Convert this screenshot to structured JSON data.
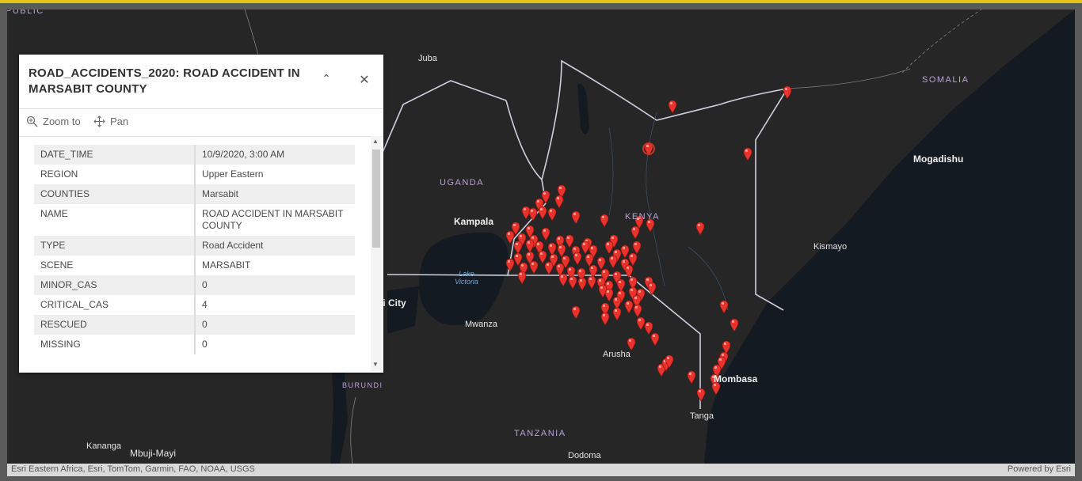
{
  "popup": {
    "title": "ROAD_ACCIDENTS_2020: ROAD ACCIDENT IN MARSABIT COUNTY",
    "zoom_label": "Zoom to",
    "pan_label": "Pan",
    "collapse_icon": "chevron-up-icon",
    "close_icon": "close-icon",
    "fields": [
      {
        "key": "DATE_TIME",
        "value": "10/9/2020, 3:00 AM"
      },
      {
        "key": "REGION",
        "value": "Upper Eastern"
      },
      {
        "key": "COUNTIES",
        "value": "Marsabit"
      },
      {
        "key": "NAME",
        "value": "ROAD ACCIDENT IN MARSABIT COUNTY"
      },
      {
        "key": "TYPE",
        "value": "Road Accident"
      },
      {
        "key": "SCENE",
        "value": "MARSABIT"
      },
      {
        "key": "MINOR_CAS",
        "value": "0"
      },
      {
        "key": "CRITICAL_CAS",
        "value": "4"
      },
      {
        "key": "RESCUED",
        "value": "0"
      },
      {
        "key": "MISSING",
        "value": "0"
      }
    ]
  },
  "map": {
    "labels": {
      "public": "PUBLIC",
      "juba": "Juba",
      "somalia": "SOMALIA",
      "mogadishu": "Mogadishu",
      "uganda": "UGANDA",
      "kampala": "Kampala",
      "kenya": "KENYA",
      "kismayo": "Kismayo",
      "lake_victoria": "Lake Victoria",
      "li_city": "li City",
      "mwanza": "Mwanza",
      "arusha": "Arusha",
      "burundi": "BURUNDI",
      "mombasa": "Mombasa",
      "tanga": "Tanga",
      "tanzania": "TANZANIA",
      "kananga": "Kananga",
      "mbuji_mayi": "Mbuji-Mayi",
      "dodoma": "Dodoma"
    },
    "marker_color": "#e8322b"
  },
  "attribution": {
    "left": "Esri Eastern Africa, Esri, TomTom, Garmin, FAO, NOAA, USGS",
    "right": "Powered by Esri"
  }
}
